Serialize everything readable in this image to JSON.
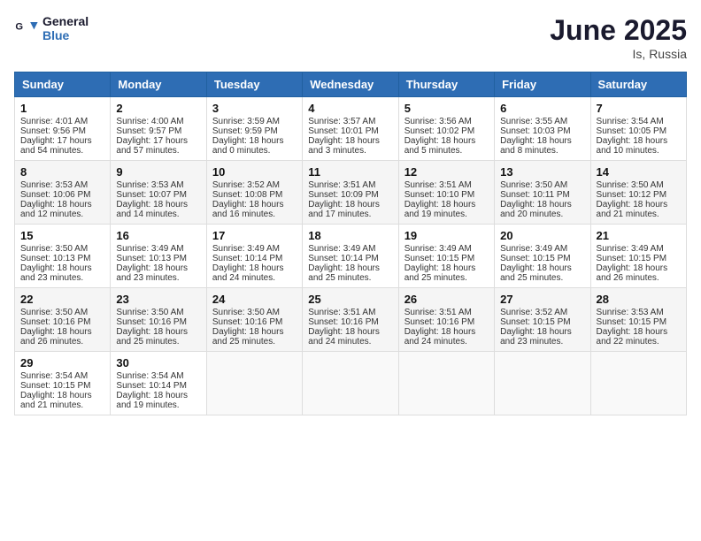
{
  "header": {
    "logo_line1": "General",
    "logo_line2": "Blue",
    "month": "June 2025",
    "location": "Is, Russia"
  },
  "days_of_week": [
    "Sunday",
    "Monday",
    "Tuesday",
    "Wednesday",
    "Thursday",
    "Friday",
    "Saturday"
  ],
  "weeks": [
    [
      {
        "day": "1",
        "sunrise": "Sunrise: 4:01 AM",
        "sunset": "Sunset: 9:56 PM",
        "daylight": "Daylight: 17 hours and 54 minutes."
      },
      {
        "day": "2",
        "sunrise": "Sunrise: 4:00 AM",
        "sunset": "Sunset: 9:57 PM",
        "daylight": "Daylight: 17 hours and 57 minutes."
      },
      {
        "day": "3",
        "sunrise": "Sunrise: 3:59 AM",
        "sunset": "Sunset: 9:59 PM",
        "daylight": "Daylight: 18 hours and 0 minutes."
      },
      {
        "day": "4",
        "sunrise": "Sunrise: 3:57 AM",
        "sunset": "Sunset: 10:01 PM",
        "daylight": "Daylight: 18 hours and 3 minutes."
      },
      {
        "day": "5",
        "sunrise": "Sunrise: 3:56 AM",
        "sunset": "Sunset: 10:02 PM",
        "daylight": "Daylight: 18 hours and 5 minutes."
      },
      {
        "day": "6",
        "sunrise": "Sunrise: 3:55 AM",
        "sunset": "Sunset: 10:03 PM",
        "daylight": "Daylight: 18 hours and 8 minutes."
      },
      {
        "day": "7",
        "sunrise": "Sunrise: 3:54 AM",
        "sunset": "Sunset: 10:05 PM",
        "daylight": "Daylight: 18 hours and 10 minutes."
      }
    ],
    [
      {
        "day": "8",
        "sunrise": "Sunrise: 3:53 AM",
        "sunset": "Sunset: 10:06 PM",
        "daylight": "Daylight: 18 hours and 12 minutes."
      },
      {
        "day": "9",
        "sunrise": "Sunrise: 3:53 AM",
        "sunset": "Sunset: 10:07 PM",
        "daylight": "Daylight: 18 hours and 14 minutes."
      },
      {
        "day": "10",
        "sunrise": "Sunrise: 3:52 AM",
        "sunset": "Sunset: 10:08 PM",
        "daylight": "Daylight: 18 hours and 16 minutes."
      },
      {
        "day": "11",
        "sunrise": "Sunrise: 3:51 AM",
        "sunset": "Sunset: 10:09 PM",
        "daylight": "Daylight: 18 hours and 17 minutes."
      },
      {
        "day": "12",
        "sunrise": "Sunrise: 3:51 AM",
        "sunset": "Sunset: 10:10 PM",
        "daylight": "Daylight: 18 hours and 19 minutes."
      },
      {
        "day": "13",
        "sunrise": "Sunrise: 3:50 AM",
        "sunset": "Sunset: 10:11 PM",
        "daylight": "Daylight: 18 hours and 20 minutes."
      },
      {
        "day": "14",
        "sunrise": "Sunrise: 3:50 AM",
        "sunset": "Sunset: 10:12 PM",
        "daylight": "Daylight: 18 hours and 21 minutes."
      }
    ],
    [
      {
        "day": "15",
        "sunrise": "Sunrise: 3:50 AM",
        "sunset": "Sunset: 10:13 PM",
        "daylight": "Daylight: 18 hours and 23 minutes."
      },
      {
        "day": "16",
        "sunrise": "Sunrise: 3:49 AM",
        "sunset": "Sunset: 10:13 PM",
        "daylight": "Daylight: 18 hours and 23 minutes."
      },
      {
        "day": "17",
        "sunrise": "Sunrise: 3:49 AM",
        "sunset": "Sunset: 10:14 PM",
        "daylight": "Daylight: 18 hours and 24 minutes."
      },
      {
        "day": "18",
        "sunrise": "Sunrise: 3:49 AM",
        "sunset": "Sunset: 10:14 PM",
        "daylight": "Daylight: 18 hours and 25 minutes."
      },
      {
        "day": "19",
        "sunrise": "Sunrise: 3:49 AM",
        "sunset": "Sunset: 10:15 PM",
        "daylight": "Daylight: 18 hours and 25 minutes."
      },
      {
        "day": "20",
        "sunrise": "Sunrise: 3:49 AM",
        "sunset": "Sunset: 10:15 PM",
        "daylight": "Daylight: 18 hours and 25 minutes."
      },
      {
        "day": "21",
        "sunrise": "Sunrise: 3:49 AM",
        "sunset": "Sunset: 10:15 PM",
        "daylight": "Daylight: 18 hours and 26 minutes."
      }
    ],
    [
      {
        "day": "22",
        "sunrise": "Sunrise: 3:50 AM",
        "sunset": "Sunset: 10:16 PM",
        "daylight": "Daylight: 18 hours and 26 minutes."
      },
      {
        "day": "23",
        "sunrise": "Sunrise: 3:50 AM",
        "sunset": "Sunset: 10:16 PM",
        "daylight": "Daylight: 18 hours and 25 minutes."
      },
      {
        "day": "24",
        "sunrise": "Sunrise: 3:50 AM",
        "sunset": "Sunset: 10:16 PM",
        "daylight": "Daylight: 18 hours and 25 minutes."
      },
      {
        "day": "25",
        "sunrise": "Sunrise: 3:51 AM",
        "sunset": "Sunset: 10:16 PM",
        "daylight": "Daylight: 18 hours and 24 minutes."
      },
      {
        "day": "26",
        "sunrise": "Sunrise: 3:51 AM",
        "sunset": "Sunset: 10:16 PM",
        "daylight": "Daylight: 18 hours and 24 minutes."
      },
      {
        "day": "27",
        "sunrise": "Sunrise: 3:52 AM",
        "sunset": "Sunset: 10:15 PM",
        "daylight": "Daylight: 18 hours and 23 minutes."
      },
      {
        "day": "28",
        "sunrise": "Sunrise: 3:53 AM",
        "sunset": "Sunset: 10:15 PM",
        "daylight": "Daylight: 18 hours and 22 minutes."
      }
    ],
    [
      {
        "day": "29",
        "sunrise": "Sunrise: 3:54 AM",
        "sunset": "Sunset: 10:15 PM",
        "daylight": "Daylight: 18 hours and 21 minutes."
      },
      {
        "day": "30",
        "sunrise": "Sunrise: 3:54 AM",
        "sunset": "Sunset: 10:14 PM",
        "daylight": "Daylight: 18 hours and 19 minutes."
      },
      null,
      null,
      null,
      null,
      null
    ]
  ]
}
